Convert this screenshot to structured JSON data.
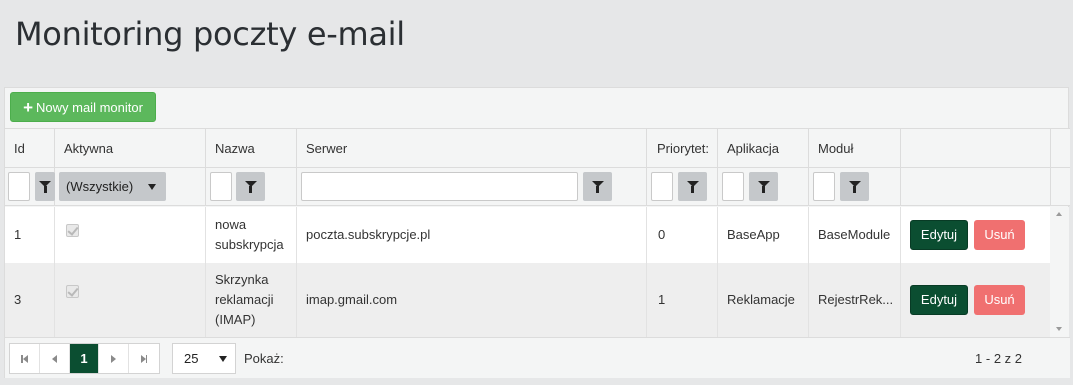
{
  "page": {
    "title": "Monitoring poczty e-mail"
  },
  "toolbar": {
    "new_button_label": "Nowy mail monitor",
    "new_button_icon": "plus-icon"
  },
  "columns": [
    {
      "key": "id",
      "label": "Id"
    },
    {
      "key": "active",
      "label": "Aktywna"
    },
    {
      "key": "name",
      "label": "Nazwa"
    },
    {
      "key": "server",
      "label": "Serwer"
    },
    {
      "key": "priority",
      "label": "Priorytet:"
    },
    {
      "key": "application",
      "label": "Aplikacja"
    },
    {
      "key": "module",
      "label": "Moduł"
    }
  ],
  "filters": {
    "active_select": "(Wszystkie)",
    "filter_icon": "filter-icon",
    "id": "",
    "name": "",
    "server": "",
    "priority": "",
    "application": "",
    "module": ""
  },
  "rows": [
    {
      "id": "1",
      "active": true,
      "name": "nowa subskrypcja",
      "server": "poczta.subskrypcje.pl",
      "priority": "0",
      "application": "BaseApp",
      "module": "BaseModule",
      "edit": "Edytuj",
      "delete": "Usuń"
    },
    {
      "id": "3",
      "active": true,
      "name": "Skrzynka reklamacji (IMAP)",
      "server": "imap.gmail.com",
      "priority": "1",
      "application": "Reklamacje",
      "module": "RejestrRek...",
      "edit": "Edytuj",
      "delete": "Usuń"
    }
  ],
  "pager": {
    "current_page": "1",
    "page_size": "25",
    "show_label": "Pokaż:",
    "info": "1 - 2 z 2"
  },
  "colors": {
    "primary_green": "#0b4e31",
    "success": "#5cb85c",
    "danger": "#f07070"
  }
}
